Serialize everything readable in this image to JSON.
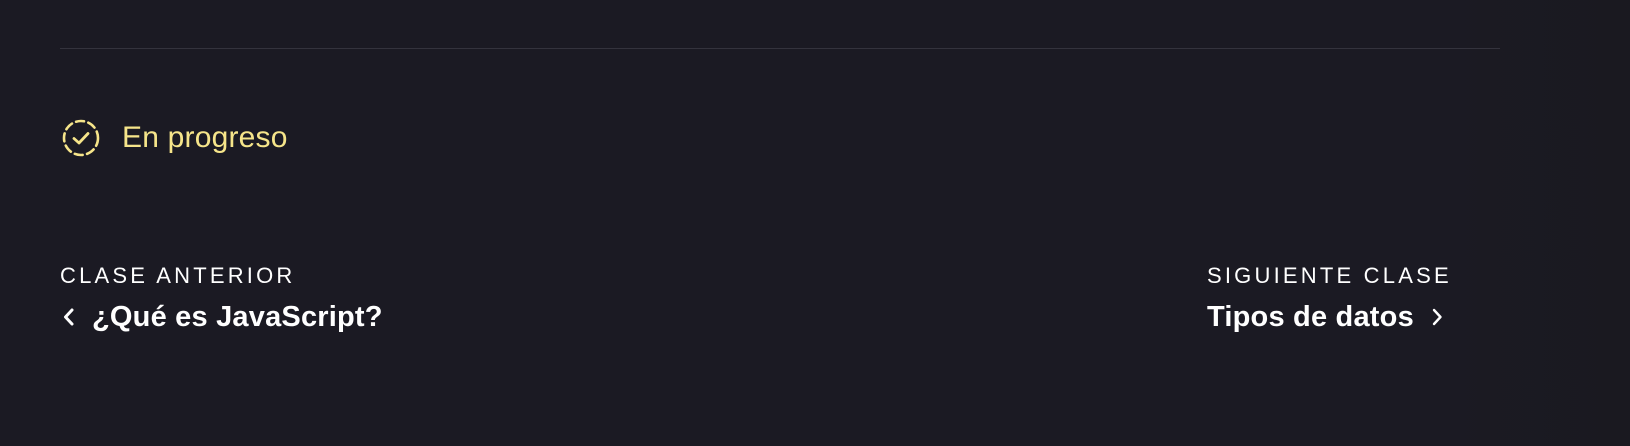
{
  "status": {
    "label": "En progreso",
    "icon": "dashed-check-circle-icon",
    "color": "#f6e58a"
  },
  "navigation": {
    "previous": {
      "caption": "CLASE ANTERIOR",
      "title": "¿Qué es JavaScript?",
      "icon": "chevron-left-icon"
    },
    "next": {
      "caption": "SIGUIENTE CLASE",
      "title": "Tipos de datos",
      "icon": "chevron-right-icon"
    }
  },
  "colors": {
    "background": "#1b1a23",
    "divider": "#34333d",
    "text": "#ffffff",
    "accent": "#f6e58a"
  }
}
